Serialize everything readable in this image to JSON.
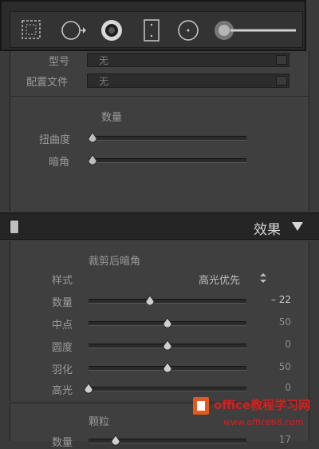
{
  "lens_panel": {
    "model_label": "型号",
    "model_value": "无",
    "profile_label": "配置文件",
    "profile_value": "无",
    "amount_heading": "数量",
    "distortion_label": "扭曲度",
    "vignetting_label": "暗角"
  },
  "effects": {
    "title": "效果",
    "post_crop_vignetting": {
      "heading": "裁剪后暗角",
      "style_label": "样式",
      "style_value": "高光优先",
      "sliders": [
        {
          "label": "数量",
          "value": "– 22",
          "level": 0.39
        },
        {
          "label": "中点",
          "value": "50",
          "level": 0.5
        },
        {
          "label": "圆度",
          "value": "0",
          "level": 0.5
        },
        {
          "label": "羽化",
          "value": "50",
          "level": 0.5
        },
        {
          "label": "高光",
          "value": "0",
          "level": 0.0
        }
      ]
    },
    "grain": {
      "heading": "颗粒",
      "amount_label": "数量",
      "amount_value": "17",
      "level": 0.17
    }
  },
  "watermark": {
    "brand": "office教程学习网",
    "url": "www.office68.com"
  },
  "colors": {
    "panel_bg": "#3f3f3f",
    "header_bg": "#252525",
    "watermark_red": "#d81e1e"
  }
}
